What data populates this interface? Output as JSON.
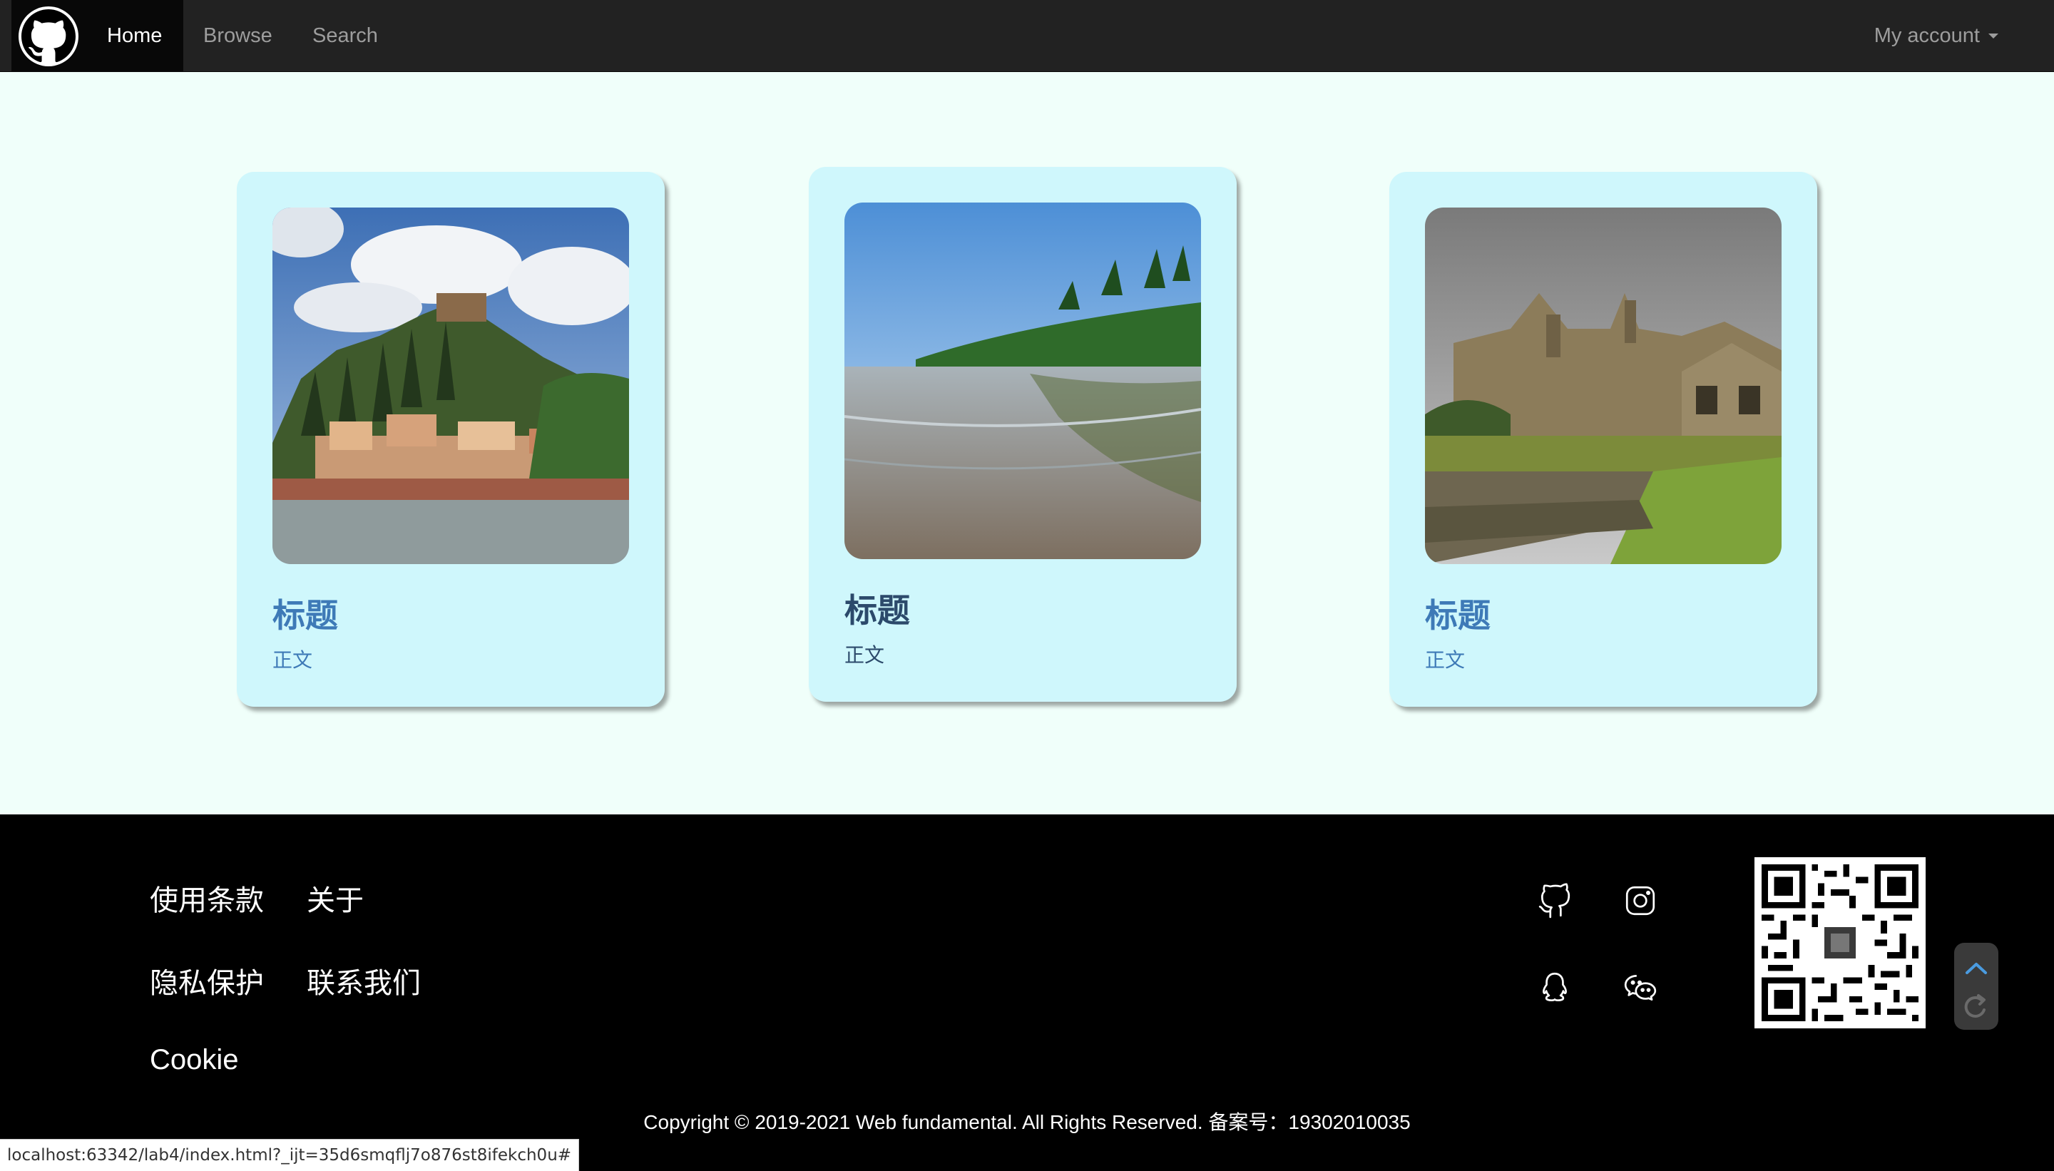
{
  "navbar": {
    "brand_icon": "github-icon",
    "items": [
      {
        "label": "Home",
        "active": true
      },
      {
        "label": "Browse",
        "active": false
      },
      {
        "label": "Search",
        "active": false
      }
    ],
    "account_label": "My account",
    "bg_color": "#222222"
  },
  "cards": [
    {
      "title": "标题",
      "body": "正文",
      "image": "hillside-town-photo"
    },
    {
      "title": "标题",
      "body": "正文",
      "image": "palm-beach-photo"
    },
    {
      "title": "标题",
      "body": "正文",
      "image": "gothic-college-photo"
    }
  ],
  "footer": {
    "links": [
      {
        "label": "使用条款"
      },
      {
        "label": "关于"
      },
      {
        "label": "隐私保护"
      },
      {
        "label": "联系我们"
      },
      {
        "label": "Cookie"
      }
    ],
    "social_icons": [
      "github-icon",
      "instagram-icon",
      "qq-icon",
      "wechat-icon"
    ],
    "qr_code": "qr-code-image",
    "copyright": "Copyright © 2019-2021 Web fundamental. All Rights Reserved. 备案号：19302010035"
  },
  "status_bar": {
    "url": "localhost:63342/lab4/index.html?_ijt=35d6smqflj7o876st8ifekch0u#"
  },
  "colors": {
    "page_bg": "#f0fffa",
    "card_bg": "#cff7fc",
    "card_text": "#3e7ab7",
    "footer_bg": "#000000"
  }
}
